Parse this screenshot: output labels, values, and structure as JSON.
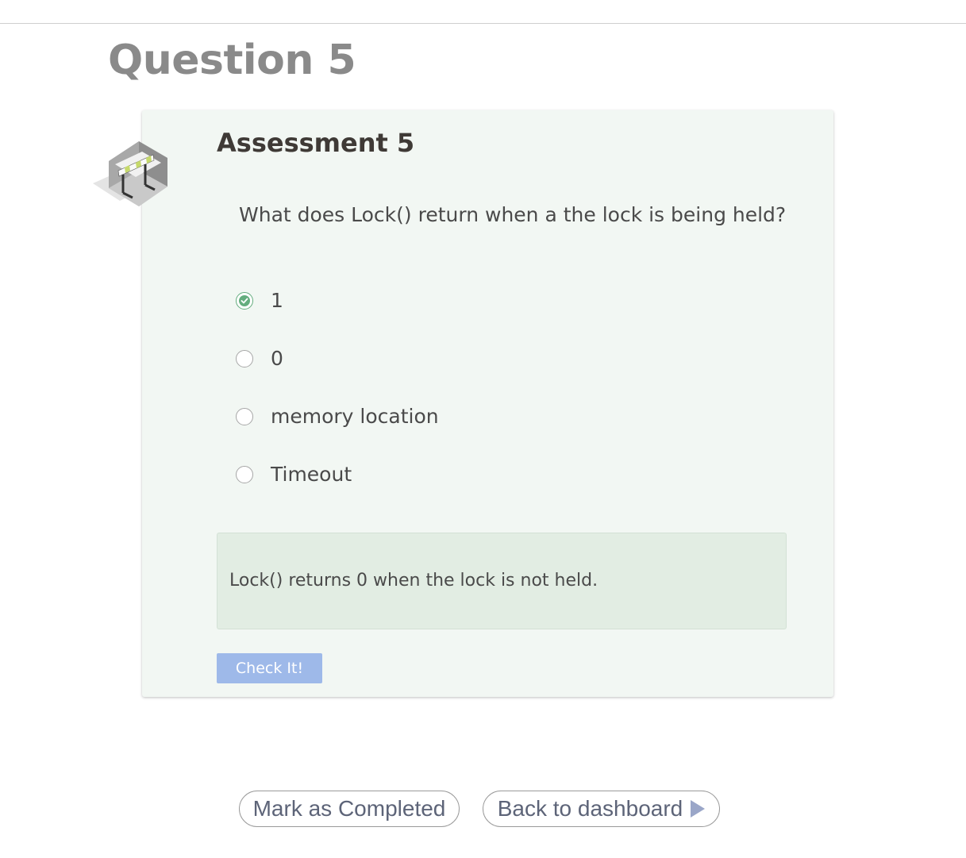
{
  "page": {
    "title": "Question 5"
  },
  "assessment": {
    "title": "Assessment 5",
    "icon": "barrier-icon",
    "question": "What does Lock() return when a the lock is being held?",
    "options": [
      {
        "label": "1",
        "selected": true
      },
      {
        "label": "0",
        "selected": false
      },
      {
        "label": "memory location",
        "selected": false
      },
      {
        "label": "Timeout",
        "selected": false
      }
    ],
    "feedback": "Lock() returns 0 when the lock is not held.",
    "check_label": "Check It!"
  },
  "footer": {
    "complete_label": "Mark as Completed",
    "back_label": "Back to dashboard",
    "back_icon": "play-icon"
  },
  "colors": {
    "card_background": "#f2f7f3",
    "feedback_background": "#e2ede3",
    "selected_radio": "#64ad7e",
    "check_button": "#9eb9e9",
    "title_gray": "#8a8a8a"
  }
}
